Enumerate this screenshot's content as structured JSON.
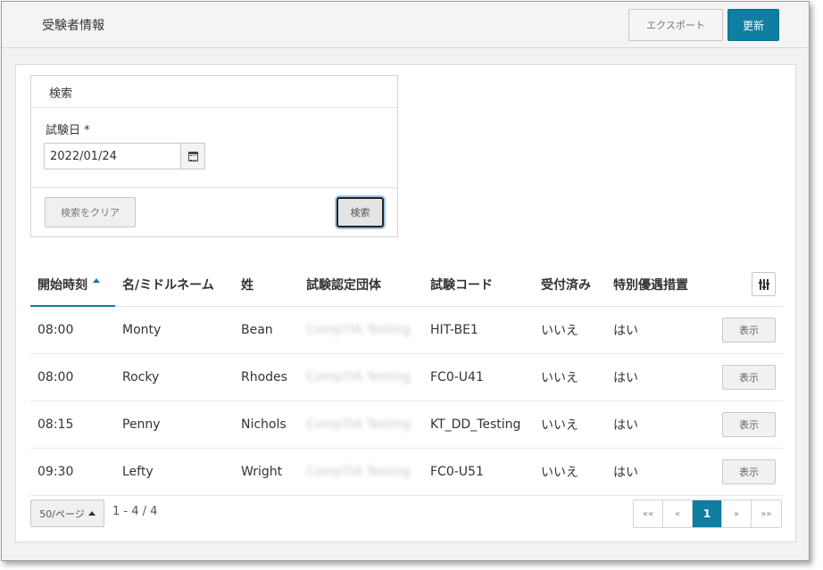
{
  "header": {
    "title": "受験者情報",
    "export_label": "エクスポート",
    "refresh_label": "更新"
  },
  "search": {
    "panel_title": "検索",
    "date_label": "試験日 *",
    "date_value": "2022/01/24",
    "clear_label": "検索をクリア",
    "search_label": "検索"
  },
  "table": {
    "columns": [
      "開始時刻",
      "名/ミドルネーム",
      "姓",
      "試験認定団体",
      "試験コード",
      "受付済み",
      "特別優遇措置"
    ],
    "sorted_column": "開始時刻",
    "rows": [
      {
        "start": "08:00",
        "first": "Monty",
        "last": "Bean",
        "org": "CompTIA Testing",
        "code": "HIT-BE1",
        "checked_in": "いいえ",
        "accommodation": "はい",
        "action": "表示"
      },
      {
        "start": "08:00",
        "first": "Rocky",
        "last": "Rhodes",
        "org": "CompTIA Testing",
        "code": "FC0-U41",
        "checked_in": "いいえ",
        "accommodation": "はい",
        "action": "表示"
      },
      {
        "start": "08:15",
        "first": "Penny",
        "last": "Nichols",
        "org": "CompTIA Testing",
        "code": "KT_DD_Testing",
        "checked_in": "いいえ",
        "accommodation": "はい",
        "action": "表示"
      },
      {
        "start": "09:30",
        "first": "Lefty",
        "last": "Wright",
        "org": "CompTIA Testing",
        "code": "FC0-U51",
        "checked_in": "いいえ",
        "accommodation": "はい",
        "action": "表示"
      }
    ]
  },
  "footer": {
    "page_size": "50/ページ",
    "range": "1 - 4 / 4",
    "pager": {
      "first": "««",
      "prev": "«",
      "current": "1",
      "next": "»",
      "last": "»»"
    }
  },
  "colors": {
    "accent": "#0e7ea1"
  }
}
